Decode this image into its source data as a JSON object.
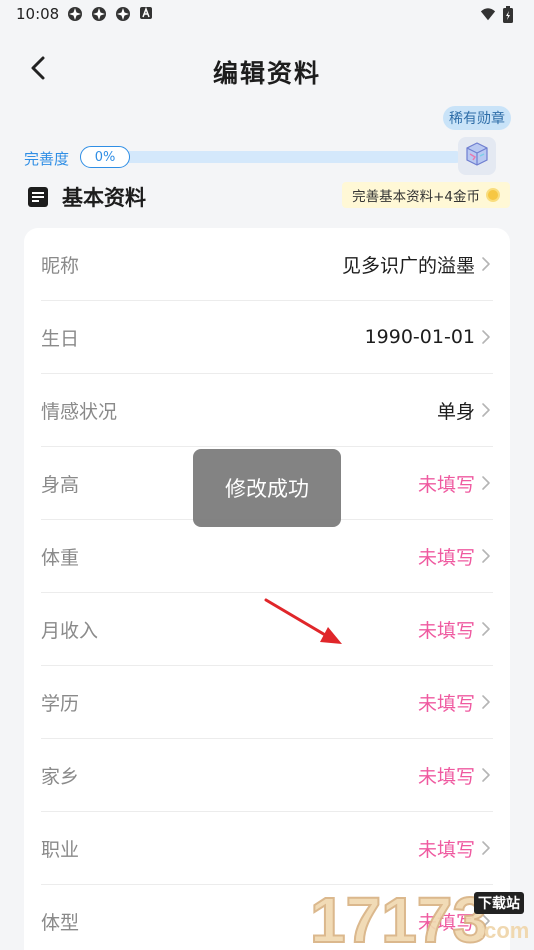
{
  "status_bar": {
    "time": "10:08",
    "icons": [
      "app-icon",
      "app-icon",
      "app-icon",
      "a-icon"
    ],
    "right_icons": [
      "wifi-icon",
      "battery-icon"
    ]
  },
  "header": {
    "title": "编辑资料",
    "back_icon": "chevron-left-icon"
  },
  "completion": {
    "label": "完善度",
    "percent_text": "0%",
    "percent_value": 0,
    "badge_tip": "稀有勋章",
    "medal_icon": "medal-cube-icon"
  },
  "section": {
    "icon": "document-icon",
    "title": "基本资料",
    "reward": "完善基本资料+4金币",
    "reward_icon": "coin-icon"
  },
  "profile_rows": [
    {
      "label": "昵称",
      "value": "见多识广的溢墨",
      "filled": true
    },
    {
      "label": "生日",
      "value": "1990-01-01",
      "filled": true
    },
    {
      "label": "情感状况",
      "value": "单身",
      "filled": true
    },
    {
      "label": "身高",
      "value": "未填写",
      "filled": false
    },
    {
      "label": "体重",
      "value": "未填写",
      "filled": false
    },
    {
      "label": "月收入",
      "value": "未填写",
      "filled": false
    },
    {
      "label": "学历",
      "value": "未填写",
      "filled": false
    },
    {
      "label": "家乡",
      "value": "未填写",
      "filled": false
    },
    {
      "label": "职业",
      "value": "未填写",
      "filled": false
    },
    {
      "label": "体型",
      "value": "未填写",
      "filled": false
    }
  ],
  "toast": {
    "message": "修改成功"
  },
  "watermark": {
    "number": "17173",
    "badge": "下载站",
    "domain": ".com"
  },
  "colors": {
    "accent_blue": "#2f8ee5",
    "empty_pink": "#ef5aa0",
    "arrow_red": "#e0262a"
  }
}
